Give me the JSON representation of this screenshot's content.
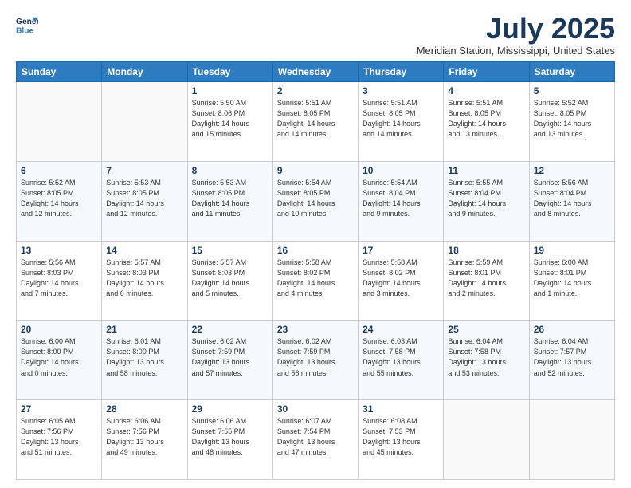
{
  "header": {
    "logo_line1": "General",
    "logo_line2": "Blue",
    "month": "July 2025",
    "location": "Meridian Station, Mississippi, United States"
  },
  "weekdays": [
    "Sunday",
    "Monday",
    "Tuesday",
    "Wednesday",
    "Thursday",
    "Friday",
    "Saturday"
  ],
  "weeks": [
    [
      {
        "day": "",
        "info": ""
      },
      {
        "day": "",
        "info": ""
      },
      {
        "day": "1",
        "info": "Sunrise: 5:50 AM\nSunset: 8:06 PM\nDaylight: 14 hours\nand 15 minutes."
      },
      {
        "day": "2",
        "info": "Sunrise: 5:51 AM\nSunset: 8:05 PM\nDaylight: 14 hours\nand 14 minutes."
      },
      {
        "day": "3",
        "info": "Sunrise: 5:51 AM\nSunset: 8:05 PM\nDaylight: 14 hours\nand 14 minutes."
      },
      {
        "day": "4",
        "info": "Sunrise: 5:51 AM\nSunset: 8:05 PM\nDaylight: 14 hours\nand 13 minutes."
      },
      {
        "day": "5",
        "info": "Sunrise: 5:52 AM\nSunset: 8:05 PM\nDaylight: 14 hours\nand 13 minutes."
      }
    ],
    [
      {
        "day": "6",
        "info": "Sunrise: 5:52 AM\nSunset: 8:05 PM\nDaylight: 14 hours\nand 12 minutes."
      },
      {
        "day": "7",
        "info": "Sunrise: 5:53 AM\nSunset: 8:05 PM\nDaylight: 14 hours\nand 12 minutes."
      },
      {
        "day": "8",
        "info": "Sunrise: 5:53 AM\nSunset: 8:05 PM\nDaylight: 14 hours\nand 11 minutes."
      },
      {
        "day": "9",
        "info": "Sunrise: 5:54 AM\nSunset: 8:05 PM\nDaylight: 14 hours\nand 10 minutes."
      },
      {
        "day": "10",
        "info": "Sunrise: 5:54 AM\nSunset: 8:04 PM\nDaylight: 14 hours\nand 9 minutes."
      },
      {
        "day": "11",
        "info": "Sunrise: 5:55 AM\nSunset: 8:04 PM\nDaylight: 14 hours\nand 9 minutes."
      },
      {
        "day": "12",
        "info": "Sunrise: 5:56 AM\nSunset: 8:04 PM\nDaylight: 14 hours\nand 8 minutes."
      }
    ],
    [
      {
        "day": "13",
        "info": "Sunrise: 5:56 AM\nSunset: 8:03 PM\nDaylight: 14 hours\nand 7 minutes."
      },
      {
        "day": "14",
        "info": "Sunrise: 5:57 AM\nSunset: 8:03 PM\nDaylight: 14 hours\nand 6 minutes."
      },
      {
        "day": "15",
        "info": "Sunrise: 5:57 AM\nSunset: 8:03 PM\nDaylight: 14 hours\nand 5 minutes."
      },
      {
        "day": "16",
        "info": "Sunrise: 5:58 AM\nSunset: 8:02 PM\nDaylight: 14 hours\nand 4 minutes."
      },
      {
        "day": "17",
        "info": "Sunrise: 5:58 AM\nSunset: 8:02 PM\nDaylight: 14 hours\nand 3 minutes."
      },
      {
        "day": "18",
        "info": "Sunrise: 5:59 AM\nSunset: 8:01 PM\nDaylight: 14 hours\nand 2 minutes."
      },
      {
        "day": "19",
        "info": "Sunrise: 6:00 AM\nSunset: 8:01 PM\nDaylight: 14 hours\nand 1 minute."
      }
    ],
    [
      {
        "day": "20",
        "info": "Sunrise: 6:00 AM\nSunset: 8:00 PM\nDaylight: 14 hours\nand 0 minutes."
      },
      {
        "day": "21",
        "info": "Sunrise: 6:01 AM\nSunset: 8:00 PM\nDaylight: 13 hours\nand 58 minutes."
      },
      {
        "day": "22",
        "info": "Sunrise: 6:02 AM\nSunset: 7:59 PM\nDaylight: 13 hours\nand 57 minutes."
      },
      {
        "day": "23",
        "info": "Sunrise: 6:02 AM\nSunset: 7:59 PM\nDaylight: 13 hours\nand 56 minutes."
      },
      {
        "day": "24",
        "info": "Sunrise: 6:03 AM\nSunset: 7:58 PM\nDaylight: 13 hours\nand 55 minutes."
      },
      {
        "day": "25",
        "info": "Sunrise: 6:04 AM\nSunset: 7:58 PM\nDaylight: 13 hours\nand 53 minutes."
      },
      {
        "day": "26",
        "info": "Sunrise: 6:04 AM\nSunset: 7:57 PM\nDaylight: 13 hours\nand 52 minutes."
      }
    ],
    [
      {
        "day": "27",
        "info": "Sunrise: 6:05 AM\nSunset: 7:56 PM\nDaylight: 13 hours\nand 51 minutes."
      },
      {
        "day": "28",
        "info": "Sunrise: 6:06 AM\nSunset: 7:56 PM\nDaylight: 13 hours\nand 49 minutes."
      },
      {
        "day": "29",
        "info": "Sunrise: 6:06 AM\nSunset: 7:55 PM\nDaylight: 13 hours\nand 48 minutes."
      },
      {
        "day": "30",
        "info": "Sunrise: 6:07 AM\nSunset: 7:54 PM\nDaylight: 13 hours\nand 47 minutes."
      },
      {
        "day": "31",
        "info": "Sunrise: 6:08 AM\nSunset: 7:53 PM\nDaylight: 13 hours\nand 45 minutes."
      },
      {
        "day": "",
        "info": ""
      },
      {
        "day": "",
        "info": ""
      }
    ]
  ]
}
